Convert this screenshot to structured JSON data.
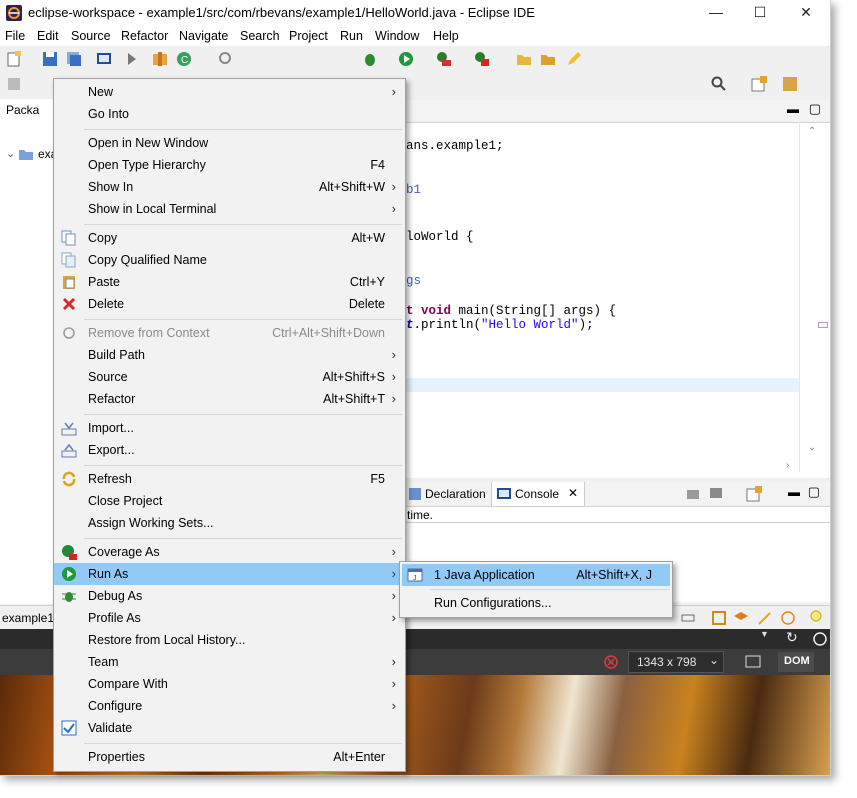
{
  "window": {
    "title": "eclipse-workspace - example1/src/com/rbevans/example1/HelloWorld.java - Eclipse IDE",
    "minimize": "—",
    "maximize": "☐",
    "close": "✕"
  },
  "menubar": [
    "File",
    "Edit",
    "Source",
    "Refactor",
    "Navigate",
    "Search",
    "Project",
    "Run",
    "Window",
    "Help"
  ],
  "package_explorer": {
    "tab_label": "Packa",
    "tree": [
      "exa"
    ]
  },
  "editor": {
    "lines": [
      {
        "text": "ans.example1;",
        "color": "#000000"
      },
      {
        "text": "b1",
        "color": "#3f5fbf"
      },
      {
        "text": "loWorld {",
        "color": "#000000"
      },
      {
        "text": "gs",
        "color": "#3f5fbf"
      },
      {
        "text": "t void main(String[] args) {",
        "color": "#000000"
      },
      {
        "text": "t.println(\"Hello World\");",
        "color": "#000000"
      }
    ]
  },
  "console": {
    "tabs": [
      "Declaration",
      "Console"
    ],
    "text": "time."
  },
  "browser": {
    "tab": "example1",
    "dimensions": "1343 x 798",
    "dom_label": "DOM"
  },
  "context_menu": {
    "items": [
      {
        "label": "New",
        "accel": "",
        "submenu": true
      },
      {
        "label": "Go Into",
        "accel": ""
      },
      {
        "label": "Open in New Window",
        "accel": ""
      },
      {
        "label": "Open Type Hierarchy",
        "accel": "F4"
      },
      {
        "label": "Show In",
        "accel": "Alt+Shift+W",
        "submenu": true
      },
      {
        "label": "Show in Local Terminal",
        "accel": "",
        "submenu": true
      },
      {
        "label": "Copy",
        "accel": "Alt+W",
        "icon": "copy-icon"
      },
      {
        "label": "Copy Qualified Name",
        "accel": "",
        "icon": "copy-qualified-icon"
      },
      {
        "label": "Paste",
        "accel": "Ctrl+Y",
        "icon": "paste-icon"
      },
      {
        "label": "Delete",
        "accel": "Delete",
        "icon": "delete-icon"
      },
      {
        "label": "Remove from Context",
        "accel": "Ctrl+Alt+Shift+Down",
        "disabled": true,
        "icon": "remove-context-icon"
      },
      {
        "label": "Build Path",
        "accel": "",
        "submenu": true
      },
      {
        "label": "Source",
        "accel": "Alt+Shift+S",
        "submenu": true
      },
      {
        "label": "Refactor",
        "accel": "Alt+Shift+T",
        "submenu": true
      },
      {
        "label": "Import...",
        "accel": "",
        "icon": "import-icon"
      },
      {
        "label": "Export...",
        "accel": "",
        "icon": "export-icon"
      },
      {
        "label": "Refresh",
        "accel": "F5",
        "icon": "refresh-icon"
      },
      {
        "label": "Close Project",
        "accel": ""
      },
      {
        "label": "Assign Working Sets...",
        "accel": ""
      },
      {
        "label": "Coverage As",
        "accel": "",
        "submenu": true,
        "icon": "coverage-icon"
      },
      {
        "label": "Run As",
        "accel": "",
        "submenu": true,
        "selected": true,
        "icon": "run-icon"
      },
      {
        "label": "Debug As",
        "accel": "",
        "submenu": true,
        "icon": "debug-icon"
      },
      {
        "label": "Profile As",
        "accel": "",
        "submenu": true
      },
      {
        "label": "Restore from Local History...",
        "accel": ""
      },
      {
        "label": "Team",
        "accel": "",
        "submenu": true
      },
      {
        "label": "Compare With",
        "accel": "",
        "submenu": true
      },
      {
        "label": "Configure",
        "accel": "",
        "submenu": true
      },
      {
        "label": "Validate",
        "accel": "",
        "icon": "checkbox-checked-icon"
      },
      {
        "label": "Properties",
        "accel": "Alt+Enter"
      }
    ]
  },
  "run_as_submenu": {
    "items": [
      {
        "label": "1 Java Application",
        "accel": "Alt+Shift+X, J",
        "icon": "java-app-icon"
      },
      {
        "label": "Run Configurations...",
        "accel": ""
      }
    ]
  },
  "colors": {
    "selection": "#91c9f7",
    "menu_bg": "#f2f2f2",
    "run_green": "#1e9a3a",
    "delete_red": "#d9262b"
  }
}
